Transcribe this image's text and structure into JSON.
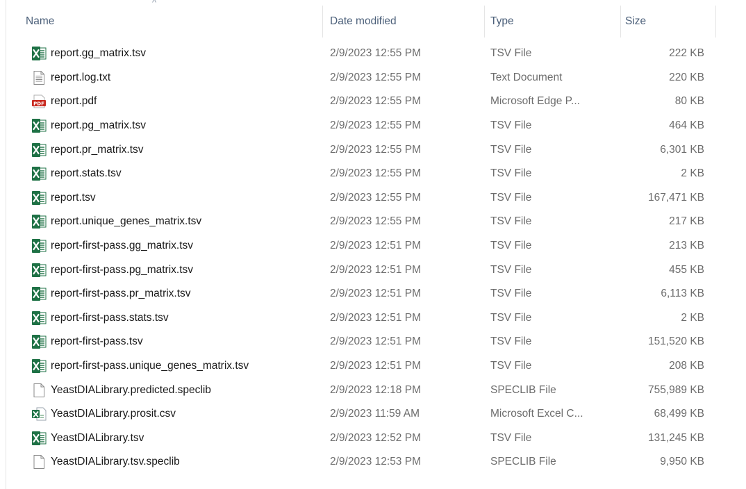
{
  "header": {
    "name": "Name",
    "date_modified": "Date modified",
    "type": "Type",
    "size": "Size",
    "sort_indicator": "^"
  },
  "colors": {
    "excel_green": "#1e7145",
    "pdf_red": "#c8281e",
    "header_text": "#4c607a"
  },
  "files": [
    {
      "icon": "excel-icon",
      "name": "report.gg_matrix.tsv",
      "date": "2/9/2023 12:55 PM",
      "type": "TSV File",
      "size": "222 KB"
    },
    {
      "icon": "text-document-icon",
      "name": "report.log.txt",
      "date": "2/9/2023 12:55 PM",
      "type": "Text Document",
      "size": "220 KB"
    },
    {
      "icon": "pdf-icon",
      "name": "report.pdf",
      "date": "2/9/2023 12:55 PM",
      "type": "Microsoft Edge P...",
      "size": "80 KB"
    },
    {
      "icon": "excel-icon",
      "name": "report.pg_matrix.tsv",
      "date": "2/9/2023 12:55 PM",
      "type": "TSV File",
      "size": "464 KB"
    },
    {
      "icon": "excel-icon",
      "name": "report.pr_matrix.tsv",
      "date": "2/9/2023 12:55 PM",
      "type": "TSV File",
      "size": "6,301 KB"
    },
    {
      "icon": "excel-icon",
      "name": "report.stats.tsv",
      "date": "2/9/2023 12:55 PM",
      "type": "TSV File",
      "size": "2 KB"
    },
    {
      "icon": "excel-icon",
      "name": "report.tsv",
      "date": "2/9/2023 12:55 PM",
      "type": "TSV File",
      "size": "167,471 KB"
    },
    {
      "icon": "excel-icon",
      "name": "report.unique_genes_matrix.tsv",
      "date": "2/9/2023 12:55 PM",
      "type": "TSV File",
      "size": "217 KB"
    },
    {
      "icon": "excel-icon",
      "name": "report-first-pass.gg_matrix.tsv",
      "date": "2/9/2023 12:51 PM",
      "type": "TSV File",
      "size": "213 KB"
    },
    {
      "icon": "excel-icon",
      "name": "report-first-pass.pg_matrix.tsv",
      "date": "2/9/2023 12:51 PM",
      "type": "TSV File",
      "size": "455 KB"
    },
    {
      "icon": "excel-icon",
      "name": "report-first-pass.pr_matrix.tsv",
      "date": "2/9/2023 12:51 PM",
      "type": "TSV File",
      "size": "6,113 KB"
    },
    {
      "icon": "excel-icon",
      "name": "report-first-pass.stats.tsv",
      "date": "2/9/2023 12:51 PM",
      "type": "TSV File",
      "size": "2 KB"
    },
    {
      "icon": "excel-icon",
      "name": "report-first-pass.tsv",
      "date": "2/9/2023 12:51 PM",
      "type": "TSV File",
      "size": "151,520 KB"
    },
    {
      "icon": "excel-icon",
      "name": "report-first-pass.unique_genes_matrix.tsv",
      "date": "2/9/2023 12:51 PM",
      "type": "TSV File",
      "size": "208 KB"
    },
    {
      "icon": "blank-file-icon",
      "name": "YeastDIALibrary.predicted.speclib",
      "date": "2/9/2023 12:18 PM",
      "type": "SPECLIB File",
      "size": "755,989 KB"
    },
    {
      "icon": "excel-csv-icon",
      "name": "YeastDIALibrary.prosit.csv",
      "date": "2/9/2023 11:59 AM",
      "type": "Microsoft Excel C...",
      "size": "68,499 KB"
    },
    {
      "icon": "excel-icon",
      "name": "YeastDIALibrary.tsv",
      "date": "2/9/2023 12:52 PM",
      "type": "TSV File",
      "size": "131,245 KB"
    },
    {
      "icon": "blank-file-icon",
      "name": "YeastDIALibrary.tsv.speclib",
      "date": "2/9/2023 12:53 PM",
      "type": "SPECLIB File",
      "size": "9,950 KB"
    }
  ]
}
